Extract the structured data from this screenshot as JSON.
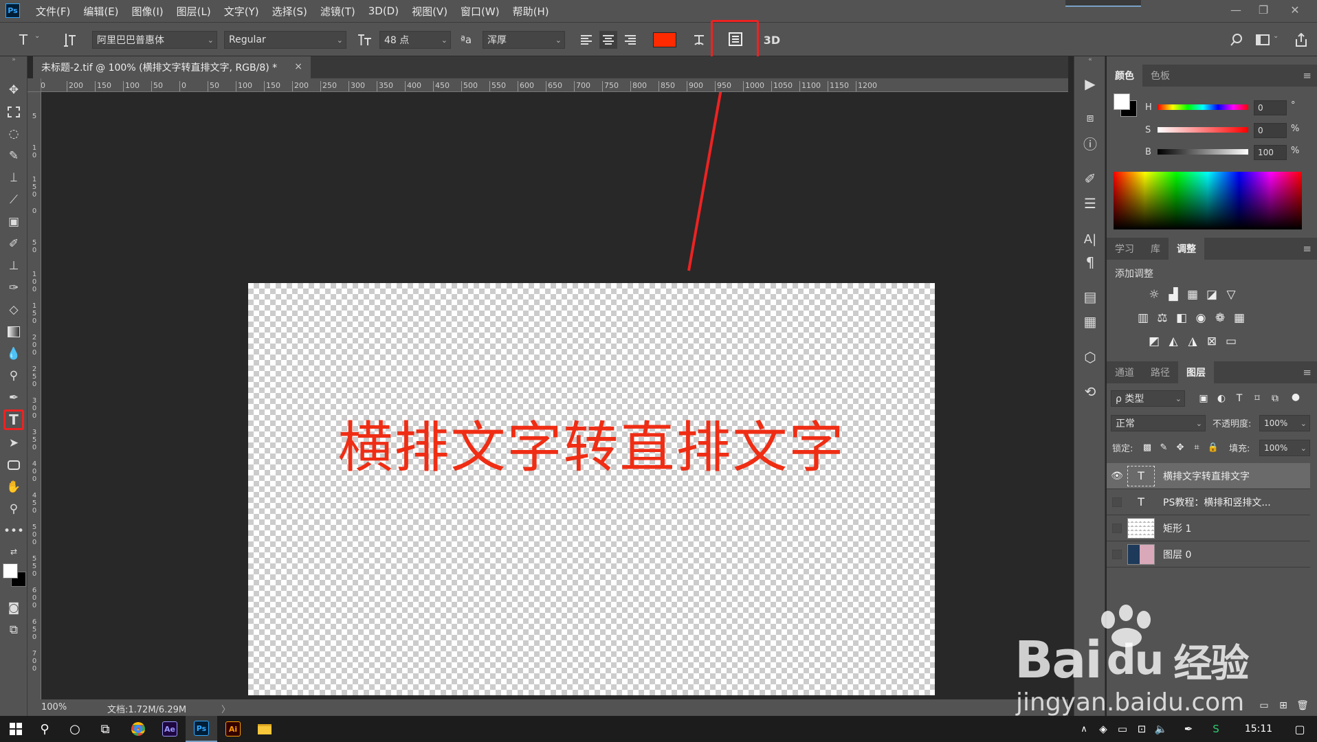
{
  "app": {
    "logo": "Ps"
  },
  "menu": [
    "文件(F)",
    "编辑(E)",
    "图像(I)",
    "图层(L)",
    "文字(Y)",
    "选择(S)",
    "滤镜(T)",
    "3D(D)",
    "视图(V)",
    "窗口(W)",
    "帮助(H)"
  ],
  "window_controls": {
    "minimize": "—",
    "restore": "❐",
    "close": "✕"
  },
  "options": {
    "tool_glyph": "T",
    "font_family": "阿里巴巴普惠体",
    "font_style": "Regular",
    "font_size": "48 点",
    "aa_label": "ªa",
    "antialias": "浑厚",
    "text_color": "#ff2a00",
    "threed_label": "3D",
    "highlight_color": "#ee2222"
  },
  "document_tab": {
    "title": "未标题-2.tif @ 100% (横排文字转直排文字, RGB/8) *",
    "close": "×"
  },
  "ruler": {
    "h_labels": [
      "0",
      "200",
      "150",
      "100",
      "50",
      "0",
      "50",
      "100",
      "150",
      "200",
      "250",
      "300",
      "350",
      "400",
      "450",
      "500",
      "550",
      "600",
      "650",
      "700",
      "750",
      "800",
      "850",
      "900",
      "950",
      "1000",
      "1050",
      "1100",
      "1150",
      "1200"
    ],
    "v_labels": [
      "0",
      "5",
      "1 0",
      "1 5 0",
      "0",
      "5 0",
      "1 0 0",
      "1 5 0",
      "2 0 0",
      "2 5 0",
      "3 0 0",
      "3 5 0",
      "4 0 0",
      "4 5 0",
      "5 0 0",
      "5 5 0",
      "6 0 0",
      "6 5 0",
      "7 0 0"
    ]
  },
  "canvas": {
    "text": "横排文字转直排文字"
  },
  "status": {
    "zoom": "100%",
    "doc": "文档:1.72M/6.29M",
    "arrow": "〉"
  },
  "color_panel": {
    "tabs": [
      "颜色",
      "色板"
    ],
    "h_label": "H",
    "s_label": "S",
    "b_label": "B",
    "h": "0",
    "s": "0",
    "b": "100",
    "h_unit": "°",
    "s_unit": "%",
    "b_unit": "%"
  },
  "adjust_panel": {
    "tabs": [
      "学习",
      "库",
      "调整"
    ],
    "heading": "添加调整"
  },
  "layers_panel": {
    "tabs": [
      "通道",
      "路径",
      "图层"
    ],
    "filter": "ρ 类型",
    "blend": "正常",
    "opacity_label": "不透明度:",
    "opacity": "100%",
    "lock_label": "锁定:",
    "fill_label": "填充:",
    "fill": "100%",
    "layers": [
      {
        "name": "横排文字转直排文字",
        "thumb": "T",
        "visible": true
      },
      {
        "name": "PS教程：横排和竖排文...",
        "thumb": "T",
        "visible": false
      },
      {
        "name": "矩形 1",
        "thumb": "",
        "visible": false
      },
      {
        "name": "图层 0",
        "thumb": "",
        "visible": false
      }
    ]
  },
  "watermark": {
    "brand": "Bai",
    "brand2": "du",
    "cn": "经验",
    "url": "jingyan.baidu.com"
  },
  "taskbar": {
    "time": "15:11",
    "apps": [
      "Ae",
      "Ps",
      "Ai"
    ]
  }
}
